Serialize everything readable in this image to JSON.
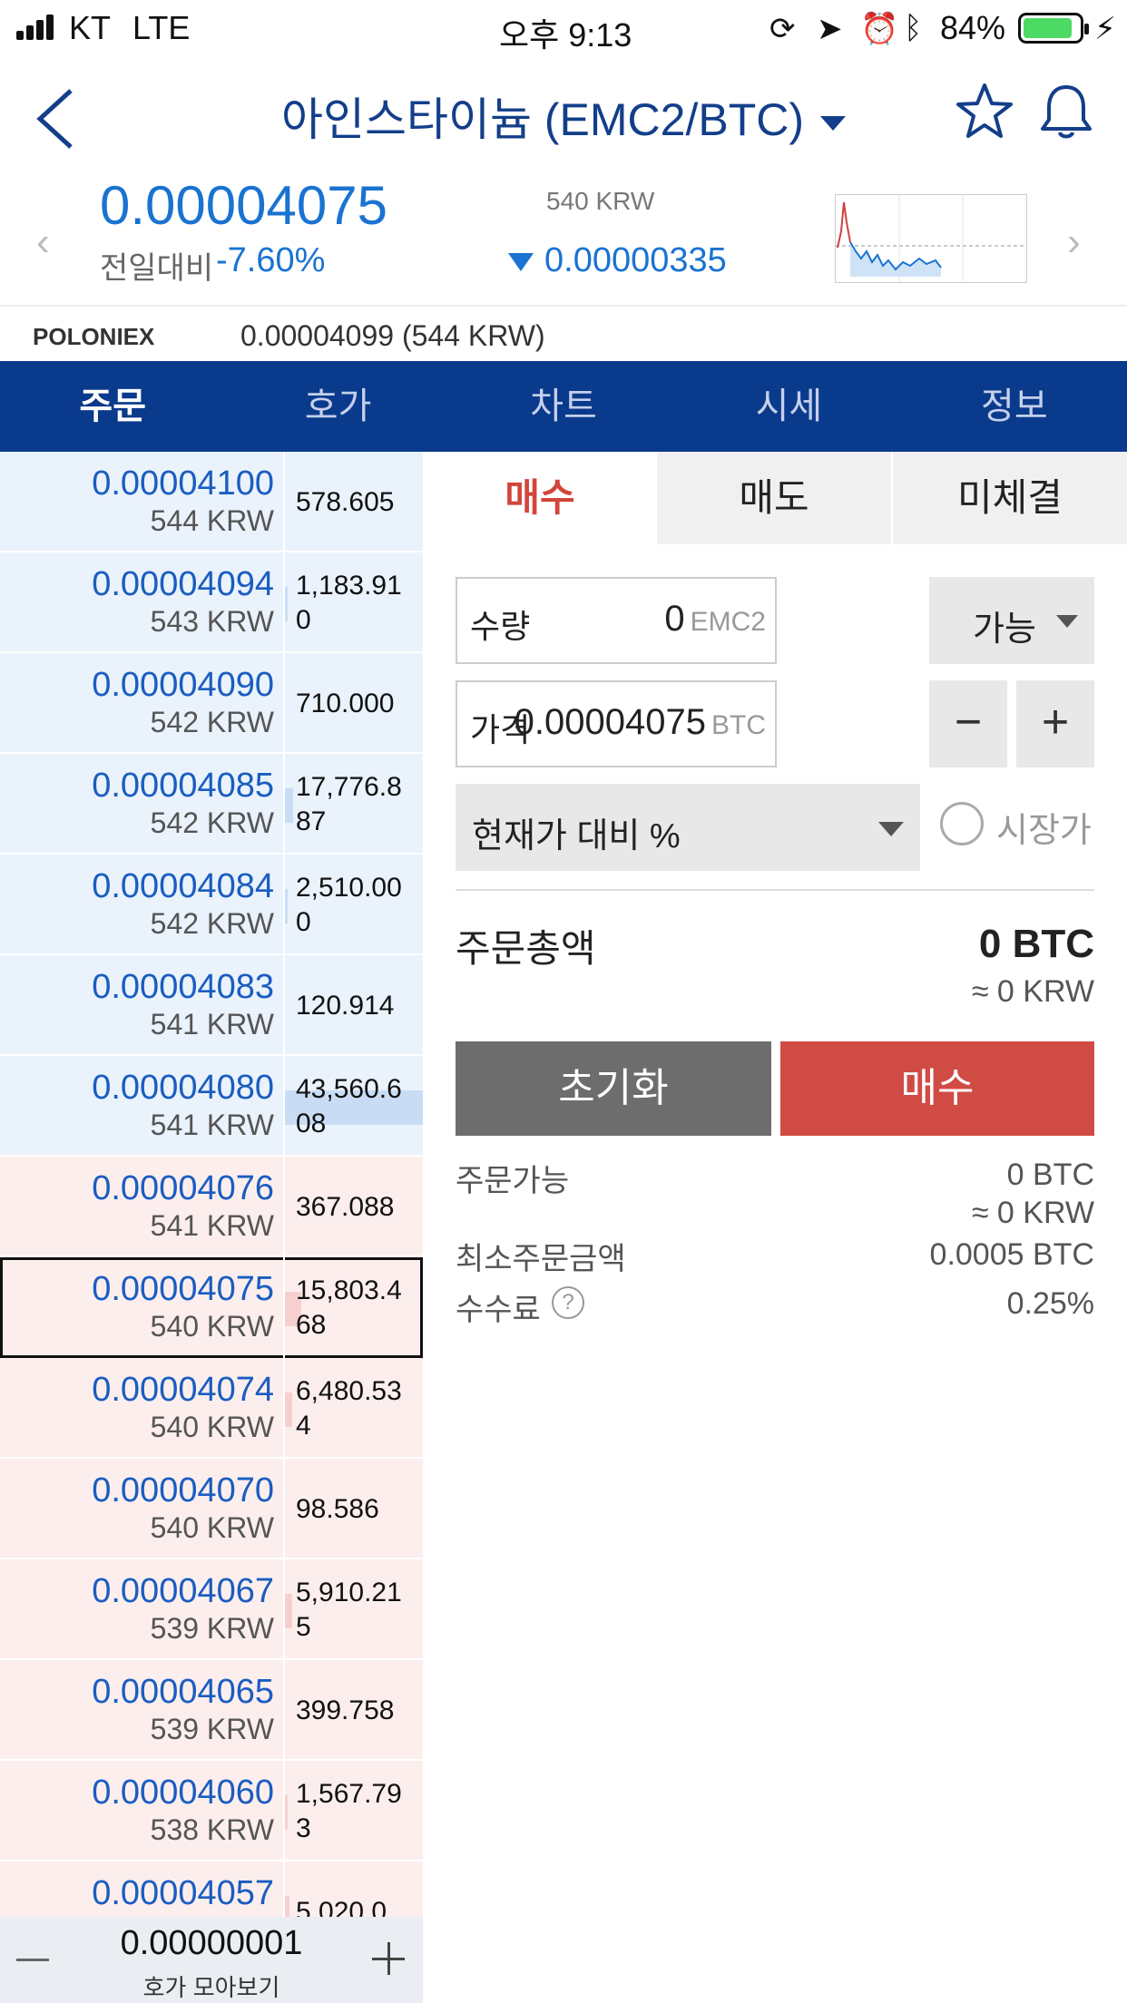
{
  "status": {
    "carrier": "KT",
    "network": "LTE",
    "time": "오후 9:13",
    "battery": "84%"
  },
  "header": {
    "title": "아인스타이늄 (EMC2/BTC)"
  },
  "summary": {
    "price": "0.00004075",
    "change_label": "전일대비",
    "change_pct": "-7.60%",
    "krw": "540 KRW",
    "change_amt": "0.00000335"
  },
  "poloniex": {
    "name": "POLONIEX",
    "value": "0.00004099 (544 KRW)"
  },
  "tabs": [
    "주문",
    "호가",
    "차트",
    "시세",
    "정보"
  ],
  "orderbook": {
    "rows": [
      {
        "price": "0.00004100",
        "krw": "544 KRW",
        "qty": "578.605",
        "side": "ask",
        "bar": 0.0
      },
      {
        "price": "0.00004094",
        "krw": "543 KRW",
        "qty": "1,183.910",
        "side": "ask",
        "bar": 0.02
      },
      {
        "price": "0.00004090",
        "krw": "542 KRW",
        "qty": "710.000",
        "side": "ask",
        "bar": 0.0
      },
      {
        "price": "0.00004085",
        "krw": "542 KRW",
        "qty": "17,776.887",
        "side": "ask",
        "bar": 0.06
      },
      {
        "price": "0.00004084",
        "krw": "542 KRW",
        "qty": "2,510.000",
        "side": "ask",
        "bar": 0.02
      },
      {
        "price": "0.00004083",
        "krw": "541 KRW",
        "qty": "120.914",
        "side": "ask",
        "bar": 0.0
      },
      {
        "price": "0.00004080",
        "krw": "541 KRW",
        "qty": "43,560.608",
        "side": "ask",
        "bar": 1.0
      },
      {
        "price": "0.00004076",
        "krw": "541 KRW",
        "qty": "367.088",
        "side": "bid",
        "bar": 0.0
      },
      {
        "price": "0.00004075",
        "krw": "540 KRW",
        "qty": "15,803.468",
        "side": "bid",
        "bar": 0.12,
        "current": true
      },
      {
        "price": "0.00004074",
        "krw": "540 KRW",
        "qty": "6,480.534",
        "side": "bid",
        "bar": 0.05
      },
      {
        "price": "0.00004070",
        "krw": "540 KRW",
        "qty": "98.586",
        "side": "bid",
        "bar": 0.0
      },
      {
        "price": "0.00004067",
        "krw": "539 KRW",
        "qty": "5,910.215",
        "side": "bid",
        "bar": 0.05
      },
      {
        "price": "0.00004065",
        "krw": "539 KRW",
        "qty": "399.758",
        "side": "bid",
        "bar": 0.0
      },
      {
        "price": "0.00004060",
        "krw": "538 KRW",
        "qty": "1,567.793",
        "side": "bid",
        "bar": 0.02
      },
      {
        "price": "0.00004057",
        "krw": "",
        "qty": "5,020.0",
        "side": "bid",
        "bar": 0.03
      }
    ],
    "step": "0.00000001",
    "step_label": "호가 모아보기"
  },
  "order": {
    "subtabs": [
      "매수",
      "매도",
      "미체결"
    ],
    "qty_label": "수량",
    "qty_value": "0",
    "qty_unit": "EMC2",
    "avail_label": "가능",
    "price_label": "가격",
    "price_value": "0.00004075",
    "price_unit": "BTC",
    "minus": "−",
    "plus": "+",
    "pct_label": "현재가 대비 %",
    "market_label": "시장가",
    "total_label": "주문총액",
    "total_btc": "0 BTC",
    "total_krw": "≈ 0 KRW",
    "reset_label": "초기화",
    "buy_label": "매수",
    "available_label": "주문가능",
    "available_btc": "0 BTC",
    "available_krw": "≈ 0 KRW",
    "min_label": "최소주문금액",
    "min_value": "0.0005 BTC",
    "fee_label": "수수료",
    "fee_value": "0.25%",
    "help": "?"
  },
  "colors": {
    "brand": "#0a3a8c",
    "buy": "#d14b45",
    "price_blue": "#1a73d1"
  }
}
